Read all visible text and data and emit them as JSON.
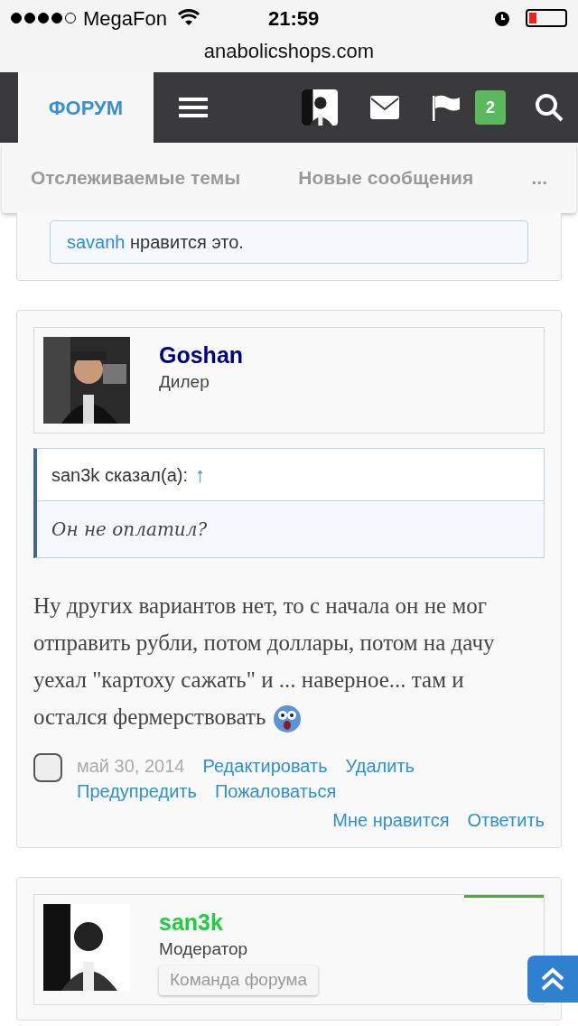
{
  "status_bar": {
    "carrier": "MegaFon",
    "time": "21:59"
  },
  "url_bar": {
    "url": "anabolicshops.com"
  },
  "nav": {
    "tabs": [
      {
        "label": "ФОРУМ",
        "selected": true
      }
    ],
    "alerts_badge": "2"
  },
  "subnav": {
    "items": [
      "Отслеживаемые темы",
      "Новые сообщения",
      "..."
    ]
  },
  "prev_post": {
    "likes": {
      "user": "savanh",
      "text": "нравится это."
    }
  },
  "posts": [
    {
      "author": "Goshan",
      "color": "#000080",
      "title": "Дилер",
      "quote": {
        "author": "san3k сказал(а):",
        "arrow": "↑",
        "text": "Он не оплатил?"
      },
      "message": "Ну других вариантов нет, то с начала он не мог отправить рубли, потом доллары, потом на дачу уехал \"картоху сажать\" и ... наверное... там и остался фермерствовать",
      "checked": false,
      "date": "май 30, 2014",
      "actions": [
        "Редактировать",
        "Удалить",
        "Предупредить",
        "Пожаловаться"
      ],
      "actions_right": [
        "Мне нравится",
        "Ответить"
      ]
    },
    {
      "author": "san3k",
      "color": "#22cc44",
      "title": "Модератор",
      "banner": "Команда форума"
    }
  ]
}
